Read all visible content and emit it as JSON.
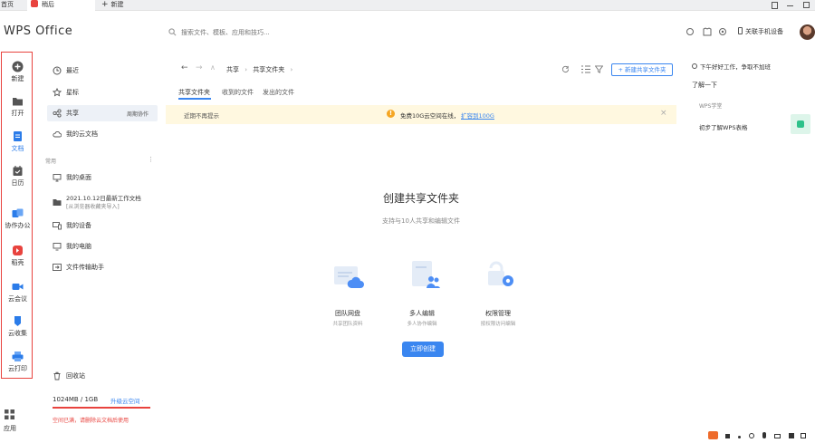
{
  "tabs": {
    "home": "首页",
    "doc": "稍后",
    "new_tab": "新建"
  },
  "brand": {
    "name": "WPS Office"
  },
  "search": {
    "placeholder": "搜索文件、模板、应用和技巧..."
  },
  "header": {
    "device_label": "关联手机设备"
  },
  "rail": {
    "items": [
      {
        "label": "新建",
        "icon": "plus-circle-icon",
        "color": "#555555"
      },
      {
        "label": "打开",
        "icon": "folder-icon",
        "color": "#555555"
      },
      {
        "label": "文档",
        "icon": "document-icon",
        "color": "#2b7ce9"
      },
      {
        "label": "日历",
        "icon": "calendar-icon",
        "color": "#555555"
      },
      {
        "label": "协作办公",
        "icon": "collab-icon",
        "color": "#2b7ce9"
      },
      {
        "label": "稻壳",
        "icon": "docer-icon",
        "color": "#e8433e"
      },
      {
        "label": "云会议",
        "icon": "video-icon",
        "color": "#2b7ce9"
      },
      {
        "label": "云收集",
        "icon": "collect-icon",
        "color": "#2b7ce9"
      },
      {
        "label": "云打印",
        "icon": "print-icon",
        "color": "#2b7ce9"
      }
    ],
    "apps_label": "应用"
  },
  "nav": {
    "recent": "最近",
    "starred": "星标",
    "shared": "共享",
    "shared_note": "周期协作",
    "cloud": "我的云文档",
    "common_header": "常用",
    "desktop": "我的桌面",
    "doc_item_line1": "2021.10.12日最新工作文档",
    "doc_item_line2": "[从浏览器收藏夹导入]",
    "devices": "我的设备",
    "pc": "我的电脑",
    "transfer": "文件传输助手",
    "trash": "回收站",
    "storage": "1024MB / 1GB",
    "upgrade": "升级云空间 ·",
    "notice": "空间已满，请删除云文档后使用"
  },
  "breadcrumb": {
    "root": "共享",
    "current": "共享文件夹"
  },
  "toolbar": {
    "new_shared_folder": "+ 新建共享文件夹"
  },
  "content_tabs": [
    "共享文件夹",
    "收到的文件",
    "发出的文件"
  ],
  "banner": {
    "dismiss": "近期不再提示",
    "message": "免费10G云空间在线，",
    "link": "扩容到100G"
  },
  "empty_state": {
    "title": "创建共享文件夹",
    "subtitle": "支持与10人共享和编辑文件",
    "features": [
      {
        "title": "团队网盘",
        "desc": "共享团队资料"
      },
      {
        "title": "多人编辑",
        "desc": "多人协作编辑"
      },
      {
        "title": "权限管理",
        "desc": "按权限访问编辑"
      }
    ],
    "create_button": "立即创建"
  },
  "right_panel": {
    "greeting": "下午好好工作，争取不加班",
    "section": "了解一下",
    "item1_label": "WPS学堂",
    "item2_label": "初步了解WPS表格"
  },
  "colors": {
    "accent": "#3a86f0",
    "highlight_border": "#e8433e",
    "banner_bg": "#fff8e0",
    "shared_active_bg": "#edf1f7"
  }
}
